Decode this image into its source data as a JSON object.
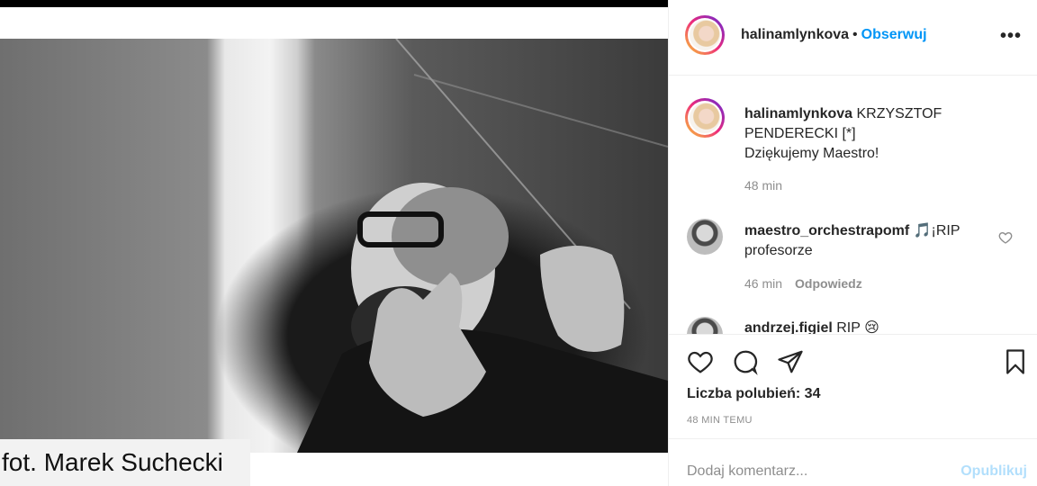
{
  "photo": {
    "credit": "fot. Marek Suchecki"
  },
  "header": {
    "username": "halinamlynkova",
    "separator": "•",
    "follow_label": "Obserwuj",
    "more_icon": "more-horizontal-icon"
  },
  "caption": {
    "username": "halinamlynkova",
    "text_line1": "KRZYSZTOF",
    "text_line2": "PENDERECKI [*]",
    "text_line3": "Dziękujemy Maestro!",
    "time": "48 min"
  },
  "comments": [
    {
      "username": "maestro_orchestrapomf",
      "emoji": "🎵",
      "text_after": "¡RIP",
      "text_line2": "profesorze",
      "time": "46 min",
      "reply_label": "Odpowiedz"
    },
    {
      "username": "andrzej.figiel",
      "text": "RIP",
      "emoji": "😢"
    }
  ],
  "actions": {
    "likes": "Liczba polubień: 34",
    "timestamp": "48 MIN TEMU"
  },
  "add_comment": {
    "placeholder": "Dodaj komentarz...",
    "publish_label": "Opublikuj"
  },
  "colors": {
    "accent": "#0095f6",
    "publish_disabled": "#b2dffc",
    "muted": "#8e8e8e"
  }
}
